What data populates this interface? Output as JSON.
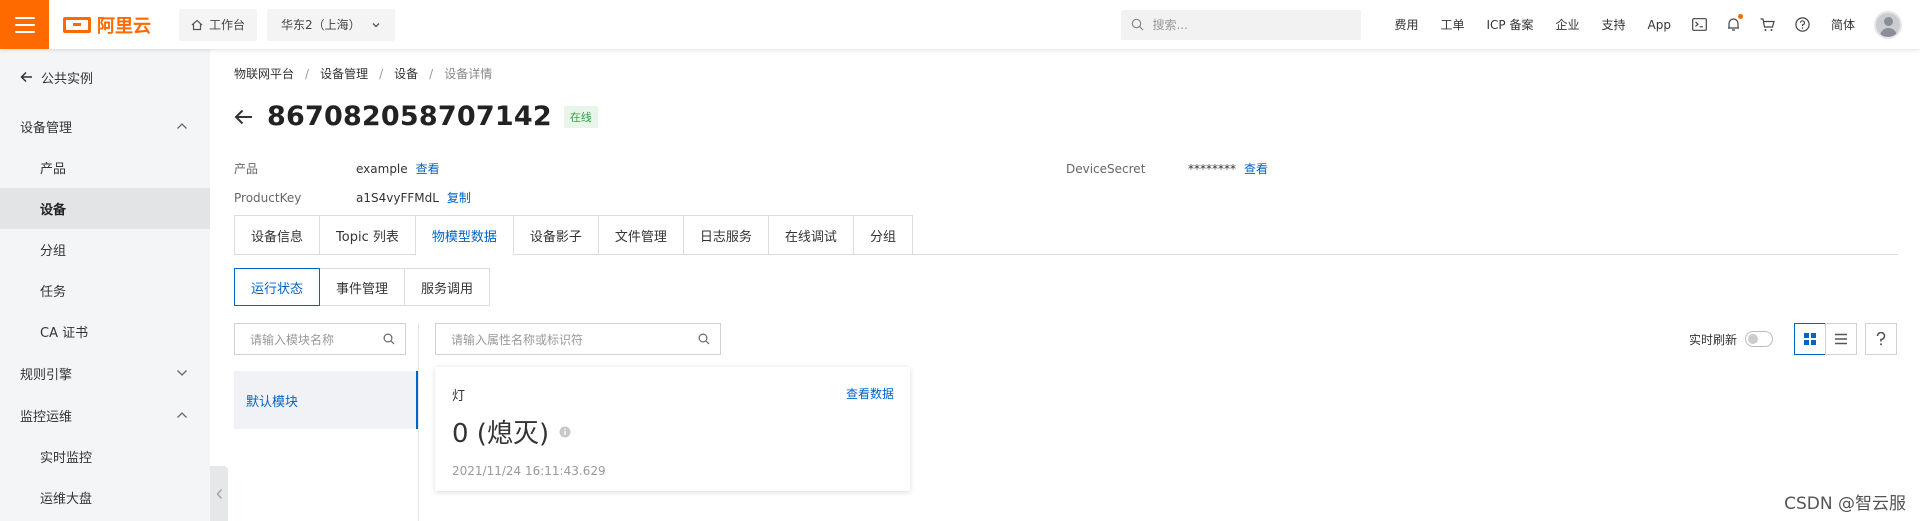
{
  "topbar": {
    "brand": "阿里云",
    "workbench": "工作台",
    "region": "华东2（上海）",
    "search_placeholder": "搜索...",
    "links": [
      "费用",
      "工单",
      "ICP 备案",
      "企业",
      "支持",
      "App"
    ],
    "language": "简体",
    "icons": [
      "terminal-icon",
      "bell-icon",
      "cart-icon",
      "help-icon"
    ]
  },
  "sidebar": {
    "back_label": "公共实例",
    "groups": [
      {
        "label": "设备管理",
        "expanded": true,
        "items": [
          "产品",
          "设备",
          "分组",
          "任务",
          "CA 证书"
        ]
      },
      {
        "label": "规则引擎",
        "expanded": false
      },
      {
        "label": "监控运维",
        "expanded": true,
        "items": [
          "实时监控",
          "运维大盘"
        ]
      }
    ],
    "active_item": "设备"
  },
  "breadcrumb": [
    "物联网平台",
    "设备管理",
    "设备",
    "设备详情"
  ],
  "device": {
    "name": "867082058707142",
    "status": "在线",
    "product_label": "产品",
    "product_value": "example",
    "product_link": "查看",
    "productkey_label": "ProductKey",
    "productkey_value": "a1S4vyFFMdL",
    "productkey_link": "复制",
    "secret_label": "DeviceSecret",
    "secret_value": "********",
    "secret_link": "查看"
  },
  "tabs": [
    "设备信息",
    "Topic 列表",
    "物模型数据",
    "设备影子",
    "文件管理",
    "日志服务",
    "在线调试",
    "分组"
  ],
  "active_tab": "物模型数据",
  "subtabs": [
    "运行状态",
    "事件管理",
    "服务调用"
  ],
  "active_subtab": "运行状态",
  "module_search_placeholder": "请输入模块名称",
  "modules": [
    "默认模块"
  ],
  "prop_search_placeholder": "请输入属性名称或标识符",
  "refresh_label": "实时刷新",
  "card": {
    "name": "灯",
    "view_link": "查看数据",
    "value": "0 (熄灭)",
    "time": "2021/11/24 16:11:43.629"
  },
  "watermark": "CSDN @智云服",
  "colors": {
    "brand": "#ff6a00",
    "link": "#0064c8",
    "online": "#3a9c47"
  }
}
